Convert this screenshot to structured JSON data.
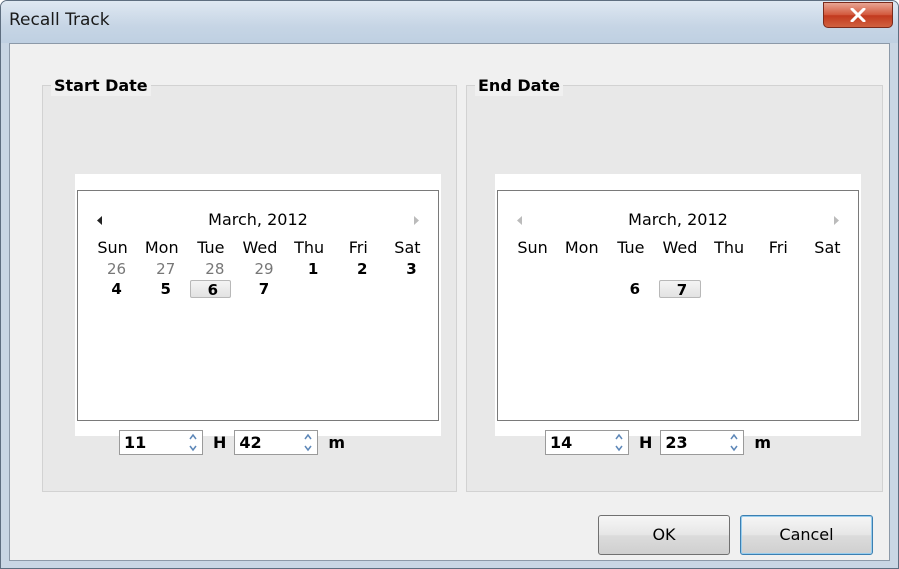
{
  "window": {
    "title": "Recall Track",
    "close_label": "X"
  },
  "start": {
    "group_title": "Start Date",
    "calendar": {
      "month_label": "March, 2012",
      "weekdays": [
        "Sun",
        "Mon",
        "Tue",
        "Wed",
        "Thu",
        "Fri",
        "Sat"
      ],
      "rows": [
        [
          {
            "d": "26",
            "other": true
          },
          {
            "d": "27",
            "other": true
          },
          {
            "d": "28",
            "other": true
          },
          {
            "d": "29",
            "other": true
          },
          {
            "d": "1"
          },
          {
            "d": "2"
          },
          {
            "d": "3"
          }
        ],
        [
          {
            "d": "4"
          },
          {
            "d": "5"
          },
          {
            "d": "6",
            "selected": true
          },
          {
            "d": "7"
          },
          {
            "d": ""
          },
          {
            "d": ""
          },
          {
            "d": ""
          }
        ]
      ]
    },
    "hours": "11",
    "hours_unit": "H",
    "minutes": "42",
    "minutes_unit": "m"
  },
  "end": {
    "group_title": "End Date",
    "calendar": {
      "month_label": "March, 2012",
      "weekdays": [
        "Sun",
        "Mon",
        "Tue",
        "Wed",
        "Thu",
        "Fri",
        "Sat"
      ],
      "rows": [
        [
          {
            "d": ""
          },
          {
            "d": ""
          },
          {
            "d": ""
          },
          {
            "d": ""
          },
          {
            "d": ""
          },
          {
            "d": ""
          },
          {
            "d": ""
          }
        ],
        [
          {
            "d": ""
          },
          {
            "d": ""
          },
          {
            "d": "6"
          },
          {
            "d": "7",
            "selected": true
          },
          {
            "d": ""
          },
          {
            "d": ""
          },
          {
            "d": ""
          }
        ]
      ]
    },
    "hours": "14",
    "hours_unit": "H",
    "minutes": "23",
    "minutes_unit": "m"
  },
  "buttons": {
    "ok_label": "OK",
    "cancel_label": "Cancel"
  },
  "icons": {
    "close": "close-icon",
    "prev": "chevron-left-icon",
    "next": "chevron-right-icon",
    "spin_up": "spin-up-icon",
    "spin_down": "spin-down-icon"
  }
}
